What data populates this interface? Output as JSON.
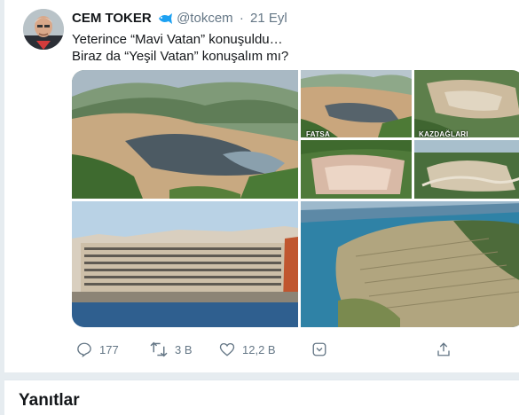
{
  "tweet": {
    "author_name": "CEM TOKER",
    "handle": "@tokcem",
    "separator": "·",
    "time": "21 Eyl",
    "text_lines": [
      "Yeterince “Mavi Vatan” konuşuldu…",
      "Biraz da “Yeşil Vatan” konuşalım mı?"
    ],
    "media": {
      "labels": [
        "FATSA",
        "KAZDAĞLARI"
      ]
    },
    "actions": {
      "reply_count": "177",
      "retweet_count": "3 B",
      "like_count": "12,2 B"
    }
  },
  "replies": {
    "title": "Yanıtlar"
  },
  "colors": {
    "text_primary": "#14171a",
    "text_secondary": "#657786",
    "badge": "#1da1f2",
    "background": "#e6ecf0"
  },
  "icons": [
    "reply-icon",
    "retweet-icon",
    "like-icon",
    "more-icon",
    "share-icon",
    "verified-fish-icon"
  ]
}
